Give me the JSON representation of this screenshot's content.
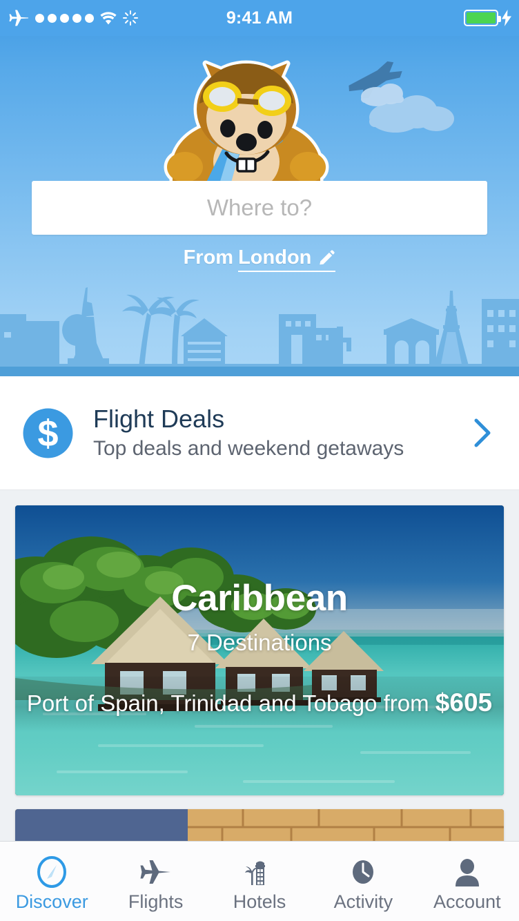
{
  "status_bar": {
    "time": "9:41 AM",
    "airplane_mode_icon": "airplane-icon",
    "signal_dots": 5,
    "wifi_icon": "wifi-icon",
    "activity_icon": "spinner-icon",
    "battery_icon": "battery-full-icon",
    "charging_icon": "lightning-bolt-icon",
    "battery_color": "#4cd551"
  },
  "hero": {
    "mascot": "chipmunk-pilot-mascot",
    "airplane_icon": "airplane-silhouette-icon",
    "clouds_icon": "cloud-icon",
    "skyline_icon": "city-skyline-silhouette",
    "sky_color_top": "#3f9ae4",
    "sky_color_bottom": "#a9d6f6"
  },
  "search": {
    "placeholder": "Where to?",
    "value": "",
    "origin_prefix": "From",
    "origin_city": "London",
    "edit_icon": "pencil-icon"
  },
  "flight_deals": {
    "icon": "dollar-circle-icon",
    "title": "Flight Deals",
    "subtitle": "Top deals and weekend getaways",
    "chevron_icon": "chevron-right-icon",
    "accent_color": "#3b9ae1"
  },
  "cards": [
    {
      "title": "Caribbean",
      "subtitle": "7 Destinations",
      "price_line": "Port of Spain, Trinidad and Tobago from ",
      "price": "$605",
      "image": "overwater-bungalows-turquoise-sea"
    },
    {
      "title": "",
      "subtitle": "",
      "price_line": "",
      "price": "",
      "image": "sandstone-ruins"
    }
  ],
  "tabbar": {
    "active_color": "#3b9ae1",
    "inactive_color": "#6b7280",
    "items": [
      {
        "label": "Discover",
        "icon": "compass-icon",
        "active": true
      },
      {
        "label": "Flights",
        "icon": "airplane-icon",
        "active": false
      },
      {
        "label": "Hotels",
        "icon": "hotel-building-palm-icon",
        "active": false
      },
      {
        "label": "Activity",
        "icon": "clock-icon",
        "active": false
      },
      {
        "label": "Account",
        "icon": "person-icon",
        "active": false
      }
    ]
  }
}
